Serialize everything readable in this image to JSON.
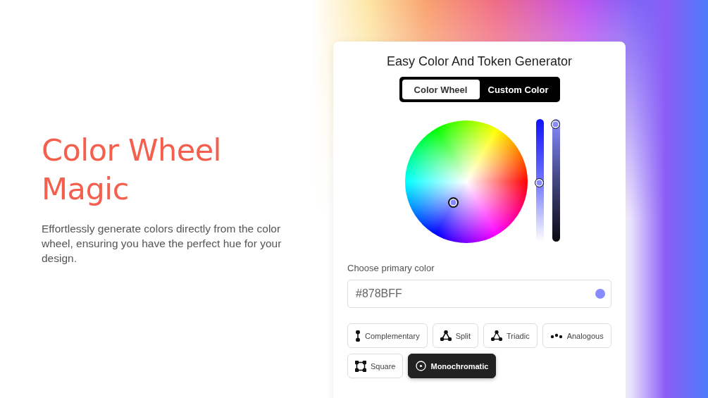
{
  "hero": {
    "title_lines": [
      "Color Wheel",
      "Magic"
    ],
    "description": "Effortlessly generate colors directly from the color wheel, ensuring you have the perfect hue for your design."
  },
  "card": {
    "title": "Easy Color And Token Generator",
    "tabs": [
      {
        "label": "Color Wheel",
        "selected": true
      },
      {
        "label": "Custom Color",
        "selected": false
      }
    ],
    "sliders": [
      {
        "kind": "lightness",
        "level": 0.48
      },
      {
        "kind": "shade",
        "level": 1
      }
    ],
    "color_field": {
      "label": "Choose primary color",
      "value": "#878BFF",
      "color": "#878bff"
    },
    "harmonies": [
      {
        "kind": "complementary",
        "label": "Complementary",
        "selected": false
      },
      {
        "kind": "split",
        "label": "Split",
        "selected": false
      },
      {
        "kind": "triadic",
        "label": "Triadic",
        "selected": false
      },
      {
        "kind": "analogous",
        "label": "Analogous",
        "selected": false
      },
      {
        "kind": "square",
        "label": "Square",
        "selected": false
      },
      {
        "kind": "monochromatic",
        "label": "Monochromatic",
        "selected": true
      }
    ]
  }
}
